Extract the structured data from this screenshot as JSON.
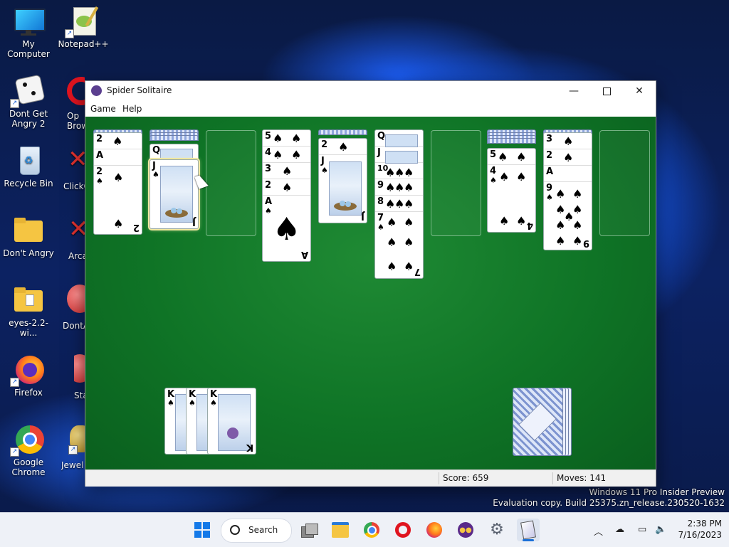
{
  "desktop": {
    "icons": [
      {
        "label": "My Computer"
      },
      {
        "label": "Notepad++"
      },
      {
        "label": "Dont Get Angry 2"
      },
      {
        "label": "Op Brow"
      },
      {
        "label": "Recycle Bin"
      },
      {
        "label": "ClickC"
      },
      {
        "label": "Don't Angry"
      },
      {
        "label": "Arca"
      },
      {
        "label": "eyes-2.2-wi..."
      },
      {
        "label": "DontA"
      },
      {
        "label": "Firefox"
      },
      {
        "label": "Sta"
      },
      {
        "label": "Google Chrome"
      },
      {
        "label": "Jewel"
      }
    ],
    "watermark_line1": "Windows 11 Pro Insider Preview",
    "watermark_line2": "Evaluation copy. Build 25375.zn_release.230520-1632"
  },
  "window": {
    "title": "Spider Solitaire",
    "menu": [
      "Game",
      "Help"
    ],
    "status": {
      "score_label": "Score: 659",
      "moves_label": "Moves:  141"
    },
    "columns": [
      {
        "cards": [
          "2",
          "A",
          "2"
        ],
        "suit": "♠"
      },
      {
        "cards": [
          "Q",
          "J"
        ],
        "suit": "♠"
      },
      {
        "cards": [],
        "suit": ""
      },
      {
        "cards": [
          "5",
          "4",
          "3",
          "2",
          "A"
        ],
        "suit": "♠"
      },
      {
        "cards": [
          "2",
          "J"
        ],
        "suit": "♠"
      },
      {
        "cards": [
          "Q",
          "J",
          "10",
          "9",
          "8",
          "7"
        ],
        "suit": "♠"
      },
      {
        "cards": [],
        "suit": ""
      },
      {
        "cards": [
          "5",
          "4"
        ],
        "suit": "♠"
      },
      {
        "cards": [
          "3",
          "2",
          "A",
          "9"
        ],
        "suit": "♠"
      },
      {
        "cards": [],
        "suit": ""
      }
    ],
    "completed": [
      "K",
      "K",
      "K"
    ]
  },
  "taskbar": {
    "search_label": "Search",
    "time": "2:38 PM",
    "date": "7/16/2023"
  }
}
